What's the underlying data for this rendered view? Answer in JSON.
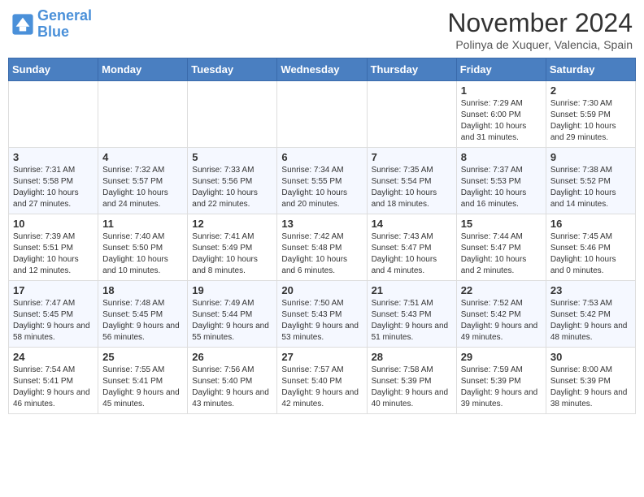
{
  "header": {
    "logo_line1": "General",
    "logo_line2": "Blue",
    "month": "November 2024",
    "location": "Polinya de Xuquer, Valencia, Spain"
  },
  "weekdays": [
    "Sunday",
    "Monday",
    "Tuesday",
    "Wednesday",
    "Thursday",
    "Friday",
    "Saturday"
  ],
  "rows": [
    [
      {
        "day": "",
        "info": ""
      },
      {
        "day": "",
        "info": ""
      },
      {
        "day": "",
        "info": ""
      },
      {
        "day": "",
        "info": ""
      },
      {
        "day": "",
        "info": ""
      },
      {
        "day": "1",
        "info": "Sunrise: 7:29 AM\nSunset: 6:00 PM\nDaylight: 10 hours and 31 minutes."
      },
      {
        "day": "2",
        "info": "Sunrise: 7:30 AM\nSunset: 5:59 PM\nDaylight: 10 hours and 29 minutes."
      }
    ],
    [
      {
        "day": "3",
        "info": "Sunrise: 7:31 AM\nSunset: 5:58 PM\nDaylight: 10 hours and 27 minutes."
      },
      {
        "day": "4",
        "info": "Sunrise: 7:32 AM\nSunset: 5:57 PM\nDaylight: 10 hours and 24 minutes."
      },
      {
        "day": "5",
        "info": "Sunrise: 7:33 AM\nSunset: 5:56 PM\nDaylight: 10 hours and 22 minutes."
      },
      {
        "day": "6",
        "info": "Sunrise: 7:34 AM\nSunset: 5:55 PM\nDaylight: 10 hours and 20 minutes."
      },
      {
        "day": "7",
        "info": "Sunrise: 7:35 AM\nSunset: 5:54 PM\nDaylight: 10 hours and 18 minutes."
      },
      {
        "day": "8",
        "info": "Sunrise: 7:37 AM\nSunset: 5:53 PM\nDaylight: 10 hours and 16 minutes."
      },
      {
        "day": "9",
        "info": "Sunrise: 7:38 AM\nSunset: 5:52 PM\nDaylight: 10 hours and 14 minutes."
      }
    ],
    [
      {
        "day": "10",
        "info": "Sunrise: 7:39 AM\nSunset: 5:51 PM\nDaylight: 10 hours and 12 minutes."
      },
      {
        "day": "11",
        "info": "Sunrise: 7:40 AM\nSunset: 5:50 PM\nDaylight: 10 hours and 10 minutes."
      },
      {
        "day": "12",
        "info": "Sunrise: 7:41 AM\nSunset: 5:49 PM\nDaylight: 10 hours and 8 minutes."
      },
      {
        "day": "13",
        "info": "Sunrise: 7:42 AM\nSunset: 5:48 PM\nDaylight: 10 hours and 6 minutes."
      },
      {
        "day": "14",
        "info": "Sunrise: 7:43 AM\nSunset: 5:47 PM\nDaylight: 10 hours and 4 minutes."
      },
      {
        "day": "15",
        "info": "Sunrise: 7:44 AM\nSunset: 5:47 PM\nDaylight: 10 hours and 2 minutes."
      },
      {
        "day": "16",
        "info": "Sunrise: 7:45 AM\nSunset: 5:46 PM\nDaylight: 10 hours and 0 minutes."
      }
    ],
    [
      {
        "day": "17",
        "info": "Sunrise: 7:47 AM\nSunset: 5:45 PM\nDaylight: 9 hours and 58 minutes."
      },
      {
        "day": "18",
        "info": "Sunrise: 7:48 AM\nSunset: 5:45 PM\nDaylight: 9 hours and 56 minutes."
      },
      {
        "day": "19",
        "info": "Sunrise: 7:49 AM\nSunset: 5:44 PM\nDaylight: 9 hours and 55 minutes."
      },
      {
        "day": "20",
        "info": "Sunrise: 7:50 AM\nSunset: 5:43 PM\nDaylight: 9 hours and 53 minutes."
      },
      {
        "day": "21",
        "info": "Sunrise: 7:51 AM\nSunset: 5:43 PM\nDaylight: 9 hours and 51 minutes."
      },
      {
        "day": "22",
        "info": "Sunrise: 7:52 AM\nSunset: 5:42 PM\nDaylight: 9 hours and 49 minutes."
      },
      {
        "day": "23",
        "info": "Sunrise: 7:53 AM\nSunset: 5:42 PM\nDaylight: 9 hours and 48 minutes."
      }
    ],
    [
      {
        "day": "24",
        "info": "Sunrise: 7:54 AM\nSunset: 5:41 PM\nDaylight: 9 hours and 46 minutes."
      },
      {
        "day": "25",
        "info": "Sunrise: 7:55 AM\nSunset: 5:41 PM\nDaylight: 9 hours and 45 minutes."
      },
      {
        "day": "26",
        "info": "Sunrise: 7:56 AM\nSunset: 5:40 PM\nDaylight: 9 hours and 43 minutes."
      },
      {
        "day": "27",
        "info": "Sunrise: 7:57 AM\nSunset: 5:40 PM\nDaylight: 9 hours and 42 minutes."
      },
      {
        "day": "28",
        "info": "Sunrise: 7:58 AM\nSunset: 5:39 PM\nDaylight: 9 hours and 40 minutes."
      },
      {
        "day": "29",
        "info": "Sunrise: 7:59 AM\nSunset: 5:39 PM\nDaylight: 9 hours and 39 minutes."
      },
      {
        "day": "30",
        "info": "Sunrise: 8:00 AM\nSunset: 5:39 PM\nDaylight: 9 hours and 38 minutes."
      }
    ]
  ]
}
